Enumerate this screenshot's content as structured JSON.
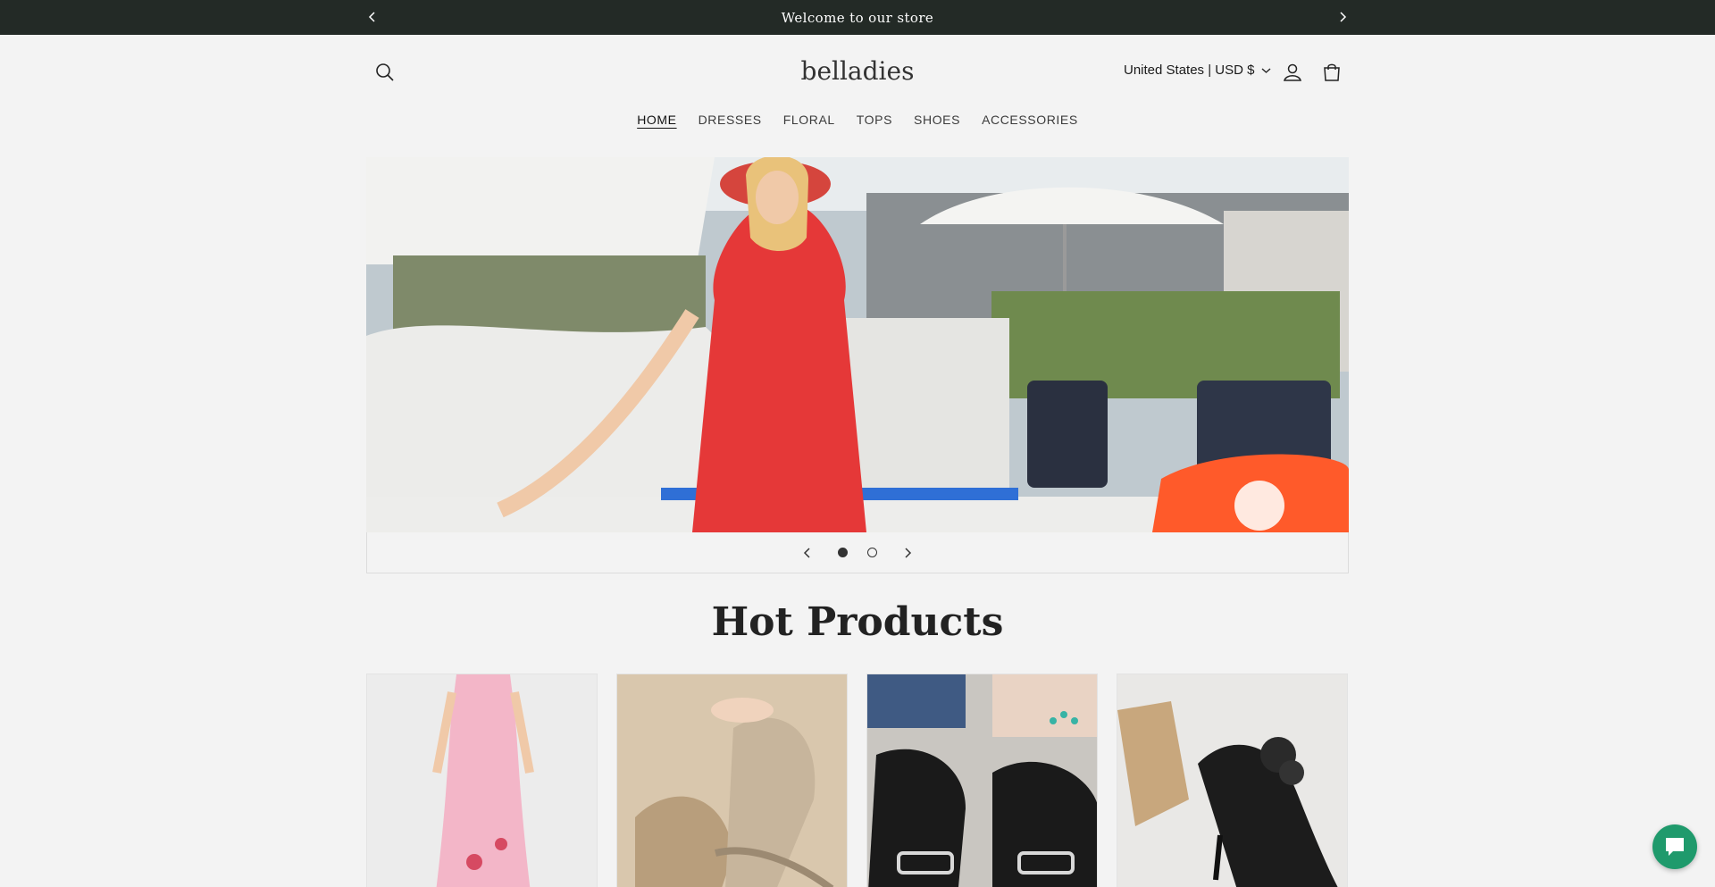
{
  "announcement": {
    "text": "Welcome to our store",
    "prev_icon": "chevron-left-icon",
    "next_icon": "chevron-right-icon"
  },
  "header": {
    "logo": "belladies",
    "country_selector": "United States | USD $",
    "icons": [
      "search-icon",
      "account-icon",
      "cart-icon"
    ]
  },
  "nav": {
    "items": [
      {
        "label": "HOME",
        "active": true
      },
      {
        "label": "DRESSES"
      },
      {
        "label": "FLORAL"
      },
      {
        "label": "TOPS"
      },
      {
        "label": "SHOES"
      },
      {
        "label": "ACCESSORIES"
      }
    ]
  },
  "slideshow": {
    "slide_count": 2,
    "active_slide": 1
  },
  "section": {
    "title": "Hot Products"
  },
  "products": [
    {
      "name": "pink-dress-image"
    },
    {
      "name": "gold-sandals-image"
    },
    {
      "name": "black-slides-image"
    },
    {
      "name": "black-heels-image"
    }
  ],
  "colors": {
    "announcement_bg": "#232a26",
    "page_bg": "#f3f3f3",
    "chat_button": "#1f9a6c"
  }
}
